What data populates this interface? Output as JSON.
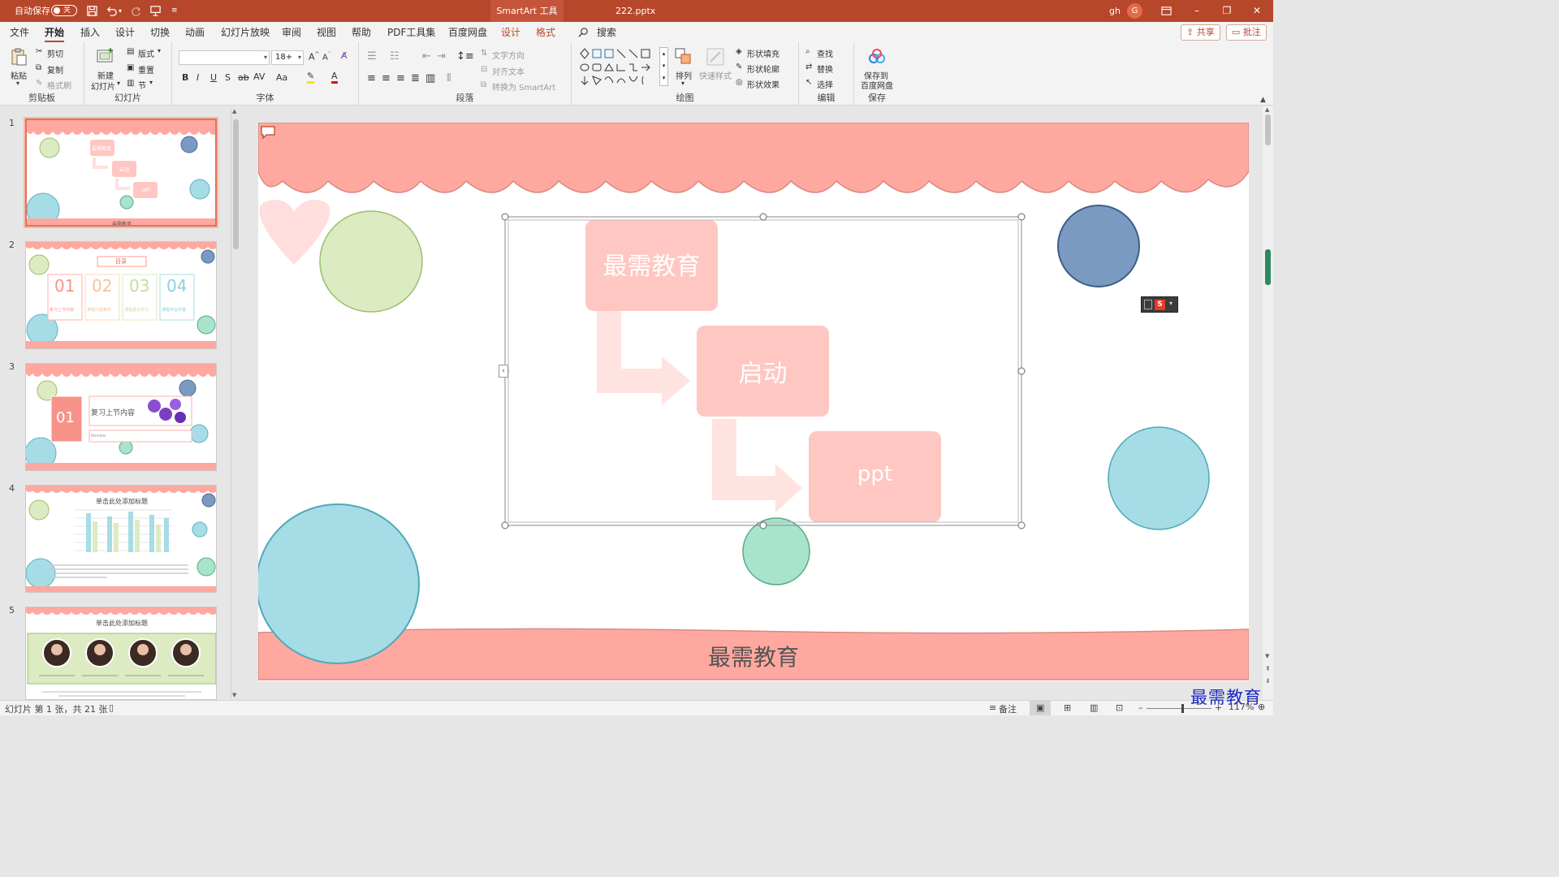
{
  "titlebar": {
    "autosave_label": "自动保存",
    "autosave_state": "关",
    "context_tab": "SmartArt 工具",
    "filename": "222.pptx",
    "user": "gh",
    "avatar_letter": "G"
  },
  "tabs": [
    "文件",
    "开始",
    "插入",
    "设计",
    "切换",
    "动画",
    "幻灯片放映",
    "审阅",
    "视图",
    "帮助",
    "PDF工具集",
    "百度网盘",
    "设计",
    "格式"
  ],
  "search_label": "搜索",
  "share_label": "共享",
  "comment_label": "批注",
  "ribbon": {
    "clipboard": {
      "label": "剪贴板",
      "paste": "粘贴",
      "cut": "剪切",
      "copy": "复制",
      "format_painter": "格式刷"
    },
    "slides": {
      "label": "幻灯片",
      "new_slide": "新建",
      "new_slide2": "幻灯片",
      "layout": "版式",
      "reset": "重置",
      "section": "节"
    },
    "font": {
      "label": "字体",
      "font_name": "",
      "font_size": "18+"
    },
    "paragraph": {
      "label": "段落",
      "text_direction": "文字方向",
      "align_text": "对齐文本",
      "convert_smartart": "转换为 SmartArt"
    },
    "drawing": {
      "label": "绘图",
      "arrange": "排列",
      "quick_styles": "快速样式",
      "shape_fill": "形状填充",
      "shape_outline": "形状轮廓",
      "shape_effects": "形状效果"
    },
    "editing": {
      "label": "编辑",
      "find": "查找",
      "replace": "替换",
      "select": "选择"
    },
    "save": {
      "label": "保存",
      "save_to": "保存到",
      "baidu": "百度网盘"
    }
  },
  "thumbnails": [
    {
      "num": "1",
      "texts": [
        "最需教育",
        "启动",
        "ppt",
        "最需教育"
      ]
    },
    {
      "num": "2",
      "title": "目录",
      "items": [
        "01",
        "02",
        "03",
        "04"
      ],
      "captions": [
        "复习上节内容",
        "课程内容教学",
        "课程重点学习",
        "课程作业布置"
      ]
    },
    {
      "num": "3",
      "number": "01",
      "heading": "复习上节内容",
      "sub": "Review"
    },
    {
      "num": "4",
      "title": "单击此处添加标题"
    },
    {
      "num": "5",
      "title": "单击此处添加标题"
    }
  ],
  "slide": {
    "box1": "最需教育",
    "box2": "启动",
    "box3": "ppt",
    "footer": "最需教育"
  },
  "statusbar": {
    "slide_info": "幻灯片 第 1 张，共 21 张",
    "notes": "备注",
    "zoom": "117%"
  },
  "watermark": "最需教育",
  "colors": {
    "accent": "#b7472a",
    "pink": "#ffa8a0",
    "smartart_box": "#ffc7c2",
    "green_circle": "#dcebc2",
    "blue_circle": "#7b9ac2",
    "cyan_circle": "#a6dce6",
    "mint_circle": "#a8e4cc"
  }
}
